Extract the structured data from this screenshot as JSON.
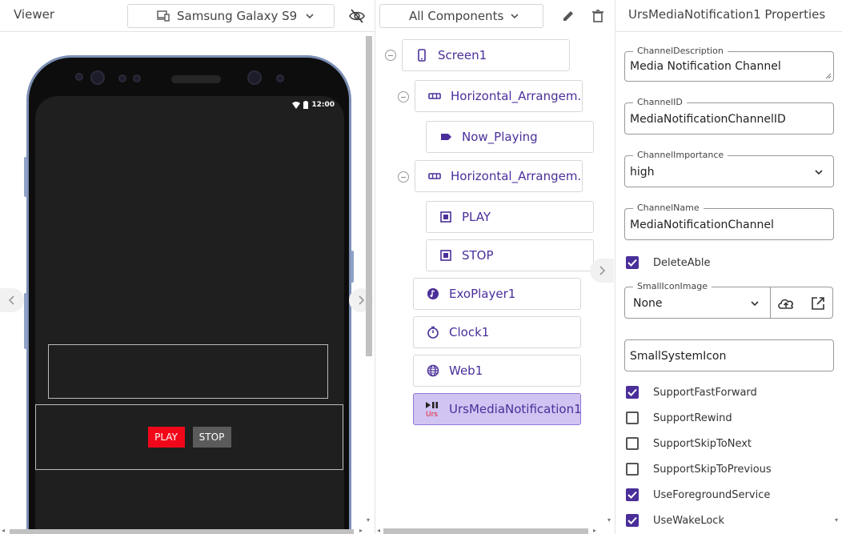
{
  "viewer": {
    "title": "Viewer",
    "device_label": "Samsung Galaxy S9",
    "status_time": "12:00",
    "play_label": "PLAY",
    "stop_label": "STOP"
  },
  "components": {
    "filter_label": "All Components",
    "tree": [
      {
        "label": "Screen1",
        "icon": "phone-icon"
      },
      {
        "label": "Horizontal_Arrangem...",
        "icon": "horizontal-arrangement-icon"
      },
      {
        "label": "Now_Playing",
        "icon": "label-icon"
      },
      {
        "label": "Horizontal_Arrangem...",
        "icon": "horizontal-arrangement-icon"
      },
      {
        "label": "PLAY",
        "icon": "button-icon"
      },
      {
        "label": "STOP",
        "icon": "button-icon"
      },
      {
        "label": "ExoPlayer1",
        "icon": "music-disc-icon"
      },
      {
        "label": "Clock1",
        "icon": "timer-icon"
      },
      {
        "label": "Web1",
        "icon": "globe-icon"
      },
      {
        "label": "UrsMediaNotification1",
        "icon": "urs-media-notification-icon"
      }
    ]
  },
  "properties": {
    "title": "UrsMediaNotification1 Properties",
    "channel_description": {
      "label": "ChannelDescription",
      "value": "Media Notification Channel"
    },
    "channel_id": {
      "label": "ChannelID",
      "value": "MediaNotificationChannelID"
    },
    "channel_importance": {
      "label": "ChannelImportance",
      "value": "high"
    },
    "channel_name": {
      "label": "ChannelName",
      "value": "MediaNotificationChannel"
    },
    "delete_able": {
      "label": "DeleteAble",
      "checked": true
    },
    "small_icon_image": {
      "label": "SmallIconImage",
      "value": "None"
    },
    "small_system_icon": {
      "value": "SmallSystemIcon"
    },
    "checkboxes": [
      {
        "label": "SupportFastForward",
        "checked": true
      },
      {
        "label": "SupportRewind",
        "checked": false
      },
      {
        "label": "SupportSkipToNext",
        "checked": false
      },
      {
        "label": "SupportSkipToPrevious",
        "checked": false
      },
      {
        "label": "UseForegroundService",
        "checked": true
      },
      {
        "label": "UseWakeLock",
        "checked": true
      }
    ]
  },
  "colors": {
    "accent": "#4a2f9a",
    "selected_bg": "#d1c4f2",
    "play_button": "#f0071a",
    "stop_button": "#5b5b5b"
  }
}
